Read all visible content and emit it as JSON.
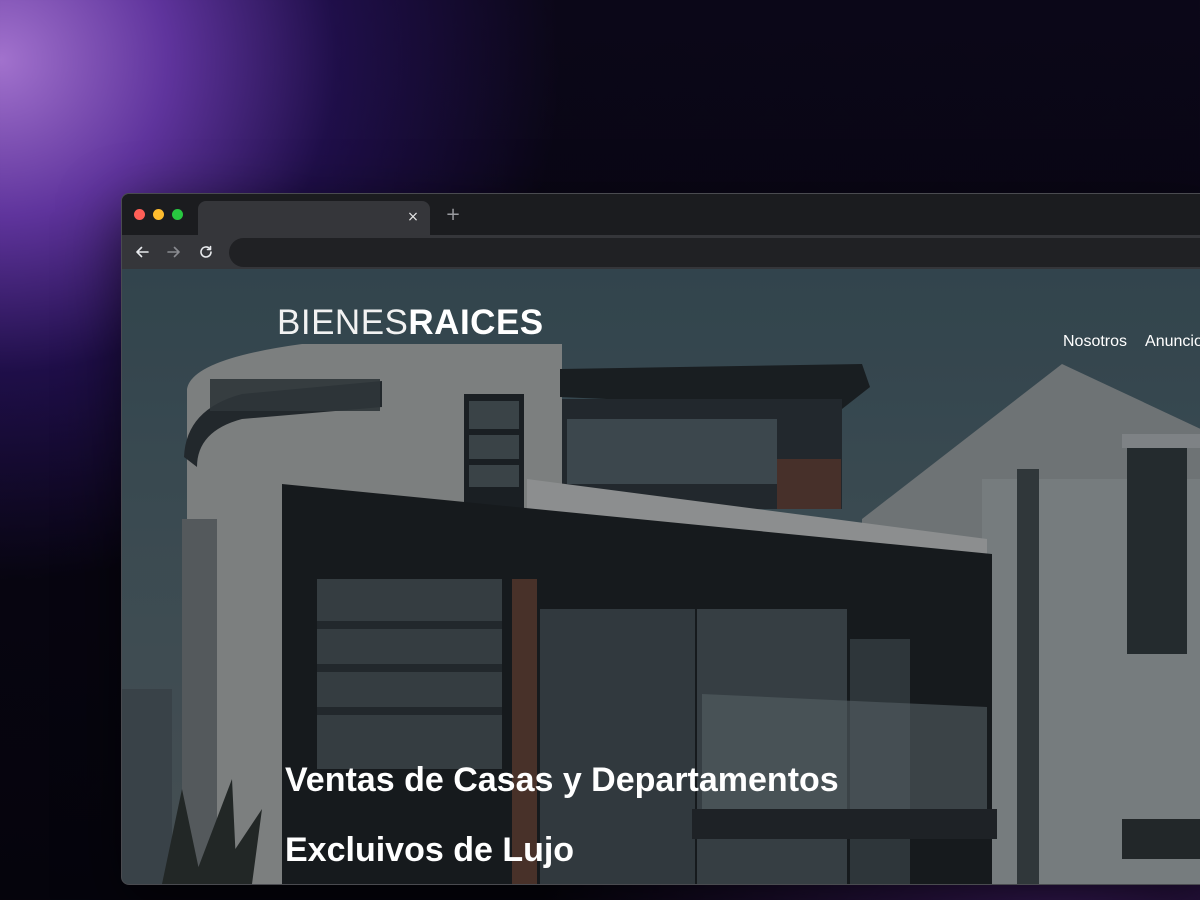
{
  "browser": {
    "tab_close": "×",
    "new_tab": "+"
  },
  "site": {
    "logo_light": "BIENES",
    "logo_bold": "RAICES",
    "nav": [
      "Nosotros",
      "Anuncios"
    ],
    "hero_line_1": "Ventas de Casas y Departamentos",
    "hero_line_2": "Excluivos de Lujo"
  },
  "colors": {
    "close_dot": "#ff5f57",
    "minimize_dot": "#febc2e",
    "maximize_dot": "#28c840"
  }
}
